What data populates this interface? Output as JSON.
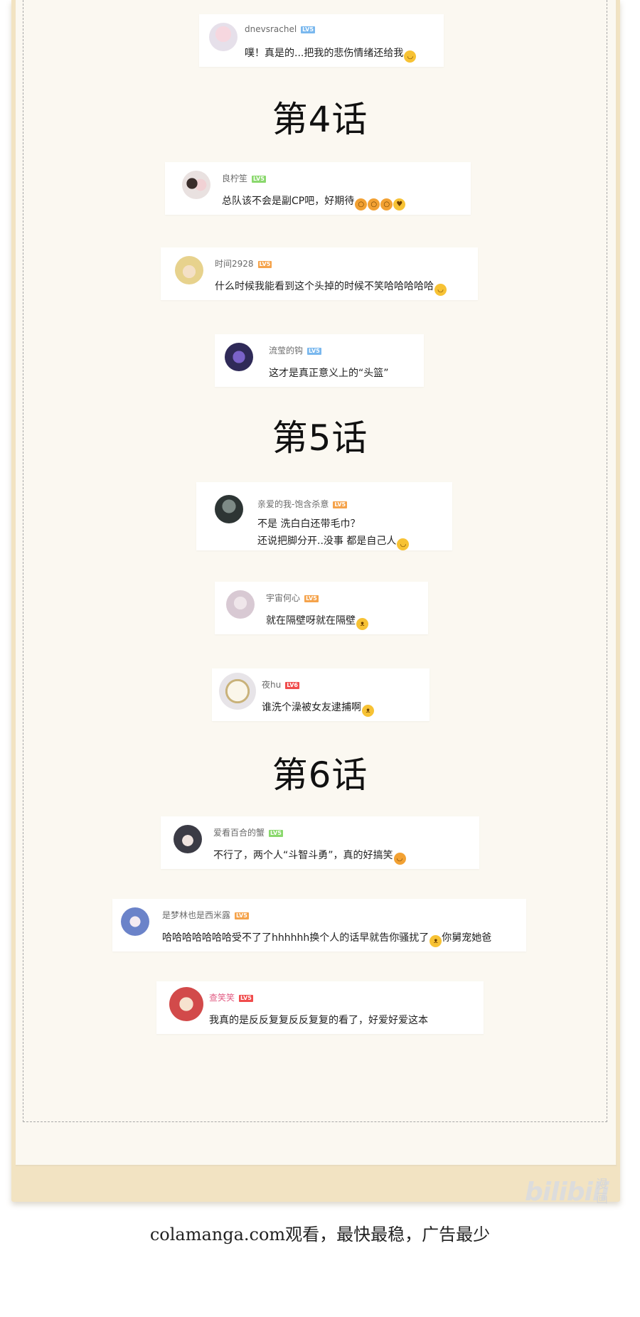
{
  "colors": {
    "paper": "#fbf8f1",
    "paper_edge": "#f2e3c2",
    "lv_green": "#8ad86d",
    "lv_orange": "#f5a34b",
    "lv_blue": "#7ab8ee",
    "lv_red": "#f04c4c",
    "pink_name": "#e25d84"
  },
  "chapters": [
    "第4话",
    "第5话",
    "第6话"
  ],
  "comments": [
    {
      "user": "dnevsrachel",
      "level": "LV5",
      "level_color": "blue",
      "avatar": "pink-hair-girl-avatar",
      "text": "噗！真是的...把我的悲伤情绪还给我",
      "emoji": [
        "sweat-smile-emoji"
      ]
    },
    {
      "user": "良柠笙",
      "level": "LV5",
      "level_color": "green",
      "avatar": "couple-avatar",
      "text": "总队该不会是副CP吧，好期待",
      "emoji": [
        "scream-emoji",
        "scream-emoji",
        "scream-emoji",
        "heart-eyes-emoji"
      ]
    },
    {
      "user": "时间2928",
      "level": "LV5",
      "level_color": "orange",
      "avatar": "blonde-girl-avatar",
      "text": "什么时候我能看到这个头掉的时候不笑哈哈哈哈哈",
      "emoji": [
        "sweat-smile-emoji"
      ]
    },
    {
      "user": "流莹的钩",
      "level": "LV5",
      "level_color": "blue",
      "avatar": "purple-character-avatar",
      "text": "这才是真正意义上的“头篮”",
      "emoji": []
    },
    {
      "user": "亲爱的我-饱含杀意",
      "level": "LV5",
      "level_color": "orange",
      "avatar": "dark-figure-avatar",
      "text": "不是 洗白白还带毛巾？",
      "text2": "还说把脚分开..没事 都是自己人",
      "emoji": [
        "smile-emoji"
      ]
    },
    {
      "user": "宇宙何心",
      "level": "LV5",
      "level_color": "orange",
      "avatar": "white-hair-avatar",
      "text": "就在隔壁呀就在隔壁",
      "emoji": [
        "cat-emoji"
      ]
    },
    {
      "user": "夜hu",
      "level": "LV6",
      "level_color": "red",
      "avatar": "ornate-frame-avatar",
      "text": "谁洗个澡被女友逮捕啊",
      "emoji": [
        "cat-emoji"
      ]
    },
    {
      "user": "爱看百合的蟹",
      "level": "LV5",
      "level_color": "green",
      "avatar": "dark-hair-boy-avatar",
      "text": "不行了，两个人“斗智斗勇”，真的好搞笑",
      "emoji": [
        "laugh-emoji"
      ]
    },
    {
      "user": "是梦林也是西米露",
      "level": "LV5",
      "level_color": "orange",
      "avatar": "blue-hair-avatar",
      "text": "哈哈哈哈哈哈哈受不了了hhhhhh换个人的话早就告你骚扰了",
      "emoji": [
        "cat-emoji"
      ],
      "text_after": "你舅宠她爸"
    },
    {
      "user": "查笑笑",
      "level": "LV5",
      "level_color": "red",
      "avatar": "red-hair-avatar",
      "text": "我真的是反反复复反反复复的看了，好爱好爱这本",
      "emoji": [],
      "pink_name": true
    }
  ],
  "watermark": {
    "brand": "bilibili",
    "manga": "漫画"
  },
  "footer": "colamanga.com观看，最快最稳，广告最少"
}
